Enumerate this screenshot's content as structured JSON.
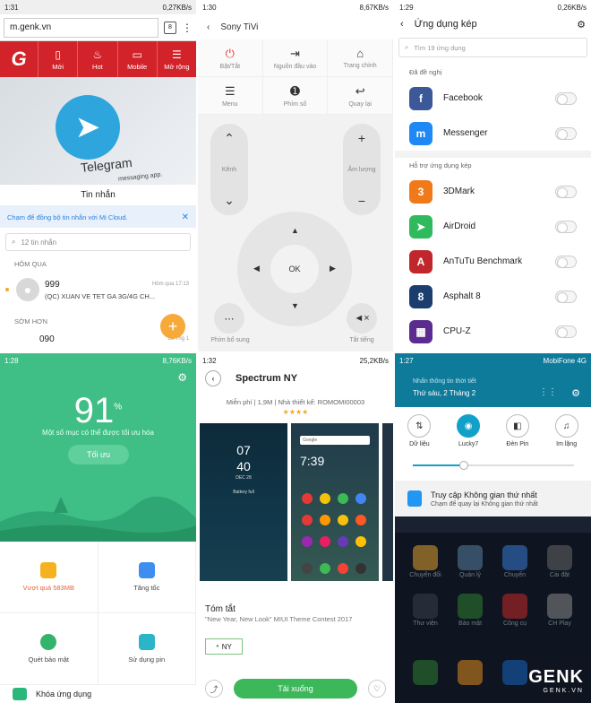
{
  "p1": {
    "status_time": "1:31",
    "status_right": "0,27KB/s",
    "url": "m.genk.vn",
    "tab_count": "8",
    "nav": [
      "Mới",
      "Hot",
      "Mobile",
      "Mở rộng"
    ],
    "hero_title": "Telegram",
    "hero_sub": "messaging app.",
    "msg_title": "Tin nhắn",
    "cloud_text": "Chạm để đồng bộ tin nhắn với Mi Cloud.",
    "search_placeholder": "12 tin nhắn",
    "section1": "HÔM QUA",
    "msg1_name": "999",
    "msg1_time": "Hôm qua 17:13",
    "msg1_text": "(QC) XUAN VE TET GA 3G/4G CH...",
    "section2": "SỚM HƠN",
    "msg2_name": "090",
    "msg2_time": "26 Thg 1"
  },
  "p2": {
    "status_time": "1:30",
    "status_right": "8,67KB/s",
    "title": "Sony TiVi",
    "grid": [
      {
        "icon": "⏻",
        "label": "Bật/Tắt"
      },
      {
        "icon": "⇥",
        "label": "Nguồn đầu vào"
      },
      {
        "icon": "⌂",
        "label": "Trang chính"
      },
      {
        "icon": "☰",
        "label": "Menu"
      },
      {
        "icon": "➊",
        "label": "Phím số"
      },
      {
        "icon": "↩",
        "label": "Quay lại"
      }
    ],
    "channel_label": "Kênh",
    "volume_label": "Âm lượng",
    "ok": "OK",
    "extra_label": "Phím bổ sung",
    "mute_label": "Tắt tiếng"
  },
  "p3": {
    "status_time": "1:29",
    "status_right": "0,26KB/s",
    "title": "Ứng dụng kép",
    "search_placeholder": "Tìm 19 ứng dụng",
    "suggest_label": "Đã đề nghị",
    "suggested": [
      {
        "name": "Facebook",
        "color": "#3b5998",
        "icon": "f"
      },
      {
        "name": "Messenger",
        "color": "#1e88f5",
        "icon": "m"
      }
    ],
    "support_label": "Hỗ trợ ứng dụng kép",
    "supported": [
      {
        "name": "3DMark",
        "color": "#f07a1a",
        "icon": "3"
      },
      {
        "name": "AirDroid",
        "color": "#2fba5e",
        "icon": "➤"
      },
      {
        "name": "AnTuTu Benchmark",
        "color": "#c0262b",
        "icon": "A"
      },
      {
        "name": "Asphalt 8",
        "color": "#1b3e6e",
        "icon": "8"
      },
      {
        "name": "CPU-Z",
        "color": "#5b2b90",
        "icon": "▦"
      }
    ]
  },
  "p4": {
    "status_time": "1:28",
    "status_right": "8,76KB/s",
    "percent": "91",
    "percent_unit": "%",
    "message": "Một số mục có thể được tối ưu hóa",
    "optimize_label": "Tối ưu",
    "cells": [
      {
        "label": "Vượt quá 583MB",
        "color": "#f5b220",
        "warn": true
      },
      {
        "label": "Tăng tốc",
        "color": "#3c8ef0",
        "warn": false
      },
      {
        "label": "Quét bảo mật",
        "color": "#33b36b",
        "warn": false
      },
      {
        "label": "Sử dụng pin",
        "color": "#2bb5c8",
        "warn": false
      }
    ],
    "bottom_label": "Khóa ứng dụng"
  },
  "p5": {
    "status_time": "1:32",
    "status_right": "25,2KB/s",
    "title": "Spectrum NY",
    "meta": "Miễn phí | 1,9M | Nhà thiết kế: ROMOMI00003",
    "stars": "★★★★",
    "lock_time_h": "07",
    "lock_time_m": "40",
    "lock_day": "DEC 28",
    "lock_battery": "Battery full",
    "home_time": "7:39",
    "google": "Google",
    "summary_title": "Tóm tắt",
    "summary_text": "\"New Year, New Look\" MIUI Theme Contest 2017",
    "tag": "NY",
    "download": "Tải xuống"
  },
  "p6": {
    "status_time": "1:27",
    "carrier": "MobiFone 4G",
    "notif_hint": "Nhấn thông tin thời tiết",
    "date": "Thứ sáu, 2 Tháng 2",
    "toggles": [
      {
        "label": "Dữ liệu",
        "icon": "⇅",
        "on": false
      },
      {
        "label": "Lucky7",
        "icon": "◉",
        "on": true
      },
      {
        "label": "Đèn Pin",
        "icon": "◧",
        "on": false
      },
      {
        "label": "Im lặng",
        "icon": "♫",
        "on": false
      }
    ],
    "notif_title": "Truy cập Không gian thứ nhất",
    "notif_sub": "Chạm để quay lại Không gian thứ nhất",
    "home_labels": [
      "Chuyển đổi",
      "Quản lý",
      "Chuyển",
      "Cài đặt",
      "Thư viện",
      "Bảo mật",
      "Công cụ",
      "CH Play"
    ],
    "watermark": "GENK",
    "watermark_sub": "GENK.VN"
  }
}
